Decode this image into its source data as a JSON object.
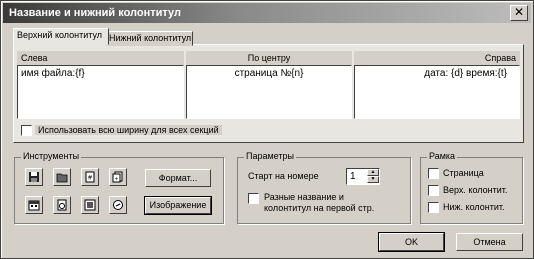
{
  "window": {
    "title": "Название и нижний колонтитул",
    "close_glyph": "✕"
  },
  "tabs": [
    {
      "label": "Верхний колонтитул",
      "active": true
    },
    {
      "label": "Нижний колонтитул",
      "active": false
    }
  ],
  "sections": {
    "left": {
      "header": "Слева",
      "value": "имя файла:{f}"
    },
    "center": {
      "header": "По центру",
      "value": "страница №{n}"
    },
    "right": {
      "header": "Справа",
      "value": "дата: {d}   время:{t}"
    }
  },
  "full_width_label": "Использовать всю ширину для всех секций",
  "tools": {
    "title": "Инструменты",
    "icons": [
      "floppy-disk-icon",
      "folder-icon",
      "page-number-icon",
      "page-count-icon",
      "date-icon",
      "time-icon",
      "filename-icon",
      "clock-icon"
    ],
    "format_label": "Формат...",
    "image_label": "Изображение"
  },
  "params": {
    "title": "Параметры",
    "start_label": "Старт на номере",
    "start_value": "1",
    "different_label_line1": "Разные название и",
    "different_label_line2": "колонтитул на первой стр."
  },
  "frame": {
    "title": "Рамка",
    "page_label": "Страница",
    "header_label": "Верх. колонтит.",
    "footer_label": "Ниж. колонтит."
  },
  "buttons": {
    "ok": "OK",
    "cancel": "Отмена"
  }
}
